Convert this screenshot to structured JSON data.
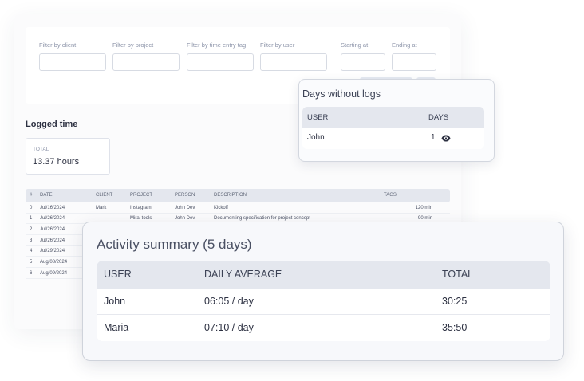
{
  "filters": {
    "client_label": "Filter by client",
    "project_label": "Filter by project",
    "tag_label": "Filter by time entry tag",
    "user_label": "Filter by user",
    "starting_label": "Starting at",
    "ending_label": "Ending at"
  },
  "logged": {
    "title": "Logged time",
    "total_label": "TOTAL",
    "total_value": "13.37 hours",
    "columns": {
      "num": "#",
      "date": "DATE",
      "client": "CLIENT",
      "project": "PROJECT",
      "person": "PERSON",
      "description": "DESCRIPTION",
      "tags": "TAGS"
    },
    "rows": [
      {
        "num": "0",
        "date": "Jul/16/2024",
        "client": "Mark",
        "project": "Instagram",
        "person": "John Dev",
        "description": "Kickoff",
        "duration": "120 min"
      },
      {
        "num": "1",
        "date": "Jul/26/2024",
        "client": "-",
        "project": "Mirai tools",
        "person": "John Dev",
        "description": "Documenting specification for project concept",
        "duration": "90 min"
      },
      {
        "num": "2",
        "date": "Jul/26/2024",
        "client": "",
        "project": "",
        "person": "",
        "description": "",
        "duration": ""
      },
      {
        "num": "3",
        "date": "Jul/26/2024",
        "client": "",
        "project": "",
        "person": "",
        "description": "",
        "duration": ""
      },
      {
        "num": "4",
        "date": "Jul/29/2024",
        "client": "",
        "project": "",
        "person": "",
        "description": "",
        "duration": ""
      },
      {
        "num": "5",
        "date": "Aug/08/2024",
        "client": "",
        "project": "",
        "person": "",
        "description": "",
        "duration": ""
      },
      {
        "num": "6",
        "date": "Aug/09/2024",
        "client": "",
        "project": "",
        "person": "",
        "description": "",
        "duration": ""
      }
    ]
  },
  "days_without_logs": {
    "title": "Days without logs",
    "col_user": "USER",
    "col_days": "DAYS",
    "rows": [
      {
        "user": "John",
        "days": "1",
        "icon": "eye-icon"
      }
    ]
  },
  "activity": {
    "title": "Activity summary (5 days)",
    "col_user": "USER",
    "col_avg": "DAILY AVERAGE",
    "col_total": "TOTAL",
    "rows": [
      {
        "user": "John",
        "avg": "06:05 / day",
        "total": "30:25"
      },
      {
        "user": "Maria",
        "avg": "07:10 / day",
        "total": "35:50"
      }
    ]
  },
  "colors": {
    "header_bg": "#e4e7ee",
    "border": "#d3d7df",
    "text": "#2d3142",
    "muted": "#8b93a8"
  }
}
